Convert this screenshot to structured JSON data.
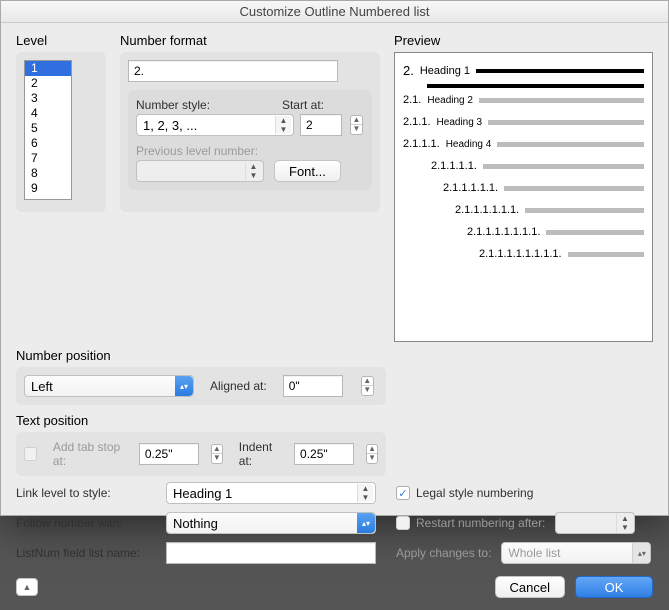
{
  "title": "Customize Outline Numbered list",
  "labels": {
    "level": "Level",
    "number_format": "Number format",
    "number_style": "Number style:",
    "start_at": "Start at:",
    "prev_level": "Previous level number:",
    "font_btn": "Font...",
    "number_position": "Number position",
    "aligned_at": "Aligned at:",
    "text_position": "Text position",
    "add_tab": "Add tab stop at:",
    "indent_at": "Indent at:",
    "link_level": "Link level to style:",
    "follow_number": "Follow number with:",
    "listnum": "ListNum field list name:",
    "legal": "Legal style numbering",
    "restart": "Restart numbering after:",
    "apply_changes": "Apply changes to:",
    "preview": "Preview",
    "cancel": "Cancel",
    "ok": "OK"
  },
  "level_list": [
    "1",
    "2",
    "3",
    "4",
    "5",
    "6",
    "7",
    "8",
    "9"
  ],
  "level_selected": 0,
  "format_value": "2.",
  "number_style": "1, 2, 3, ...",
  "start_at": "2",
  "prev_level_value": "",
  "position_align": "Left",
  "aligned_at_value": "0\"",
  "tab_stop_value": "0.25\"",
  "indent_at_value": "0.25\"",
  "link_style": "Heading 1",
  "follow_with": "Nothing",
  "listnum_value": "",
  "legal_checked": true,
  "restart_checked": false,
  "restart_value": "",
  "apply_changes_value": "Whole list",
  "preview": [
    {
      "num": "2.",
      "head": "Heading 1",
      "dark": true,
      "indent": 0,
      "second": true
    },
    {
      "num": "2.1.",
      "head": "Heading 2",
      "dark": false,
      "indent": 0
    },
    {
      "num": "2.1.1.",
      "head": "Heading 3",
      "dark": false,
      "indent": 0
    },
    {
      "num": "2.1.1.1.",
      "head": "Heading 4",
      "dark": false,
      "indent": 0
    },
    {
      "num": "2.1.1.1.1.",
      "head": "",
      "dark": false,
      "indent": 28
    },
    {
      "num": "2.1.1.1.1.1.",
      "head": "",
      "dark": false,
      "indent": 40
    },
    {
      "num": "2.1.1.1.1.1.1.",
      "head": "",
      "dark": false,
      "indent": 52
    },
    {
      "num": "2.1.1.1.1.1.1.1.",
      "head": "",
      "dark": false,
      "indent": 64
    },
    {
      "num": "2.1.1.1.1.1.1.1.1.",
      "head": "",
      "dark": false,
      "indent": 76
    }
  ]
}
